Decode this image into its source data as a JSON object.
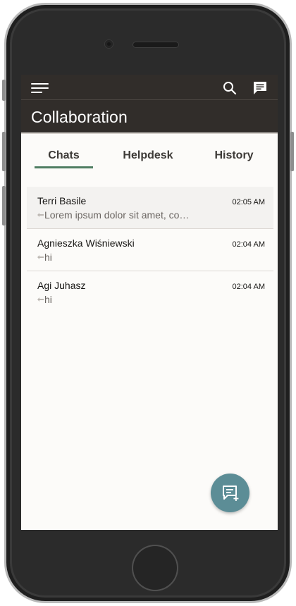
{
  "app": {
    "title": "Collaboration"
  },
  "header": {
    "icons": [
      "hamburger-menu-icon",
      "search-icon",
      "chat-bubble-icon"
    ]
  },
  "tabs": [
    {
      "label": "Chats",
      "active": true
    },
    {
      "label": "Helpdesk",
      "active": false
    },
    {
      "label": "History",
      "active": false
    }
  ],
  "chats": [
    {
      "name": "Terri Basile",
      "preview": "Lorem ipsum dolor sit amet, co…",
      "time": "02:05 AM",
      "selected": true
    },
    {
      "name": "Agnieszka Wiśniewski",
      "preview": "hi",
      "time": "02:04 AM",
      "selected": false
    },
    {
      "name": "Agi Juhasz",
      "preview": "hi",
      "time": "02:04 AM",
      "selected": false
    }
  ],
  "fab": {
    "icon": "new-chat-icon"
  },
  "colors": {
    "header_bg": "#312d2a",
    "tab_indicator": "#4f7d62",
    "fab_bg": "#5c8d96",
    "screen_bg": "#fcfbf9"
  }
}
